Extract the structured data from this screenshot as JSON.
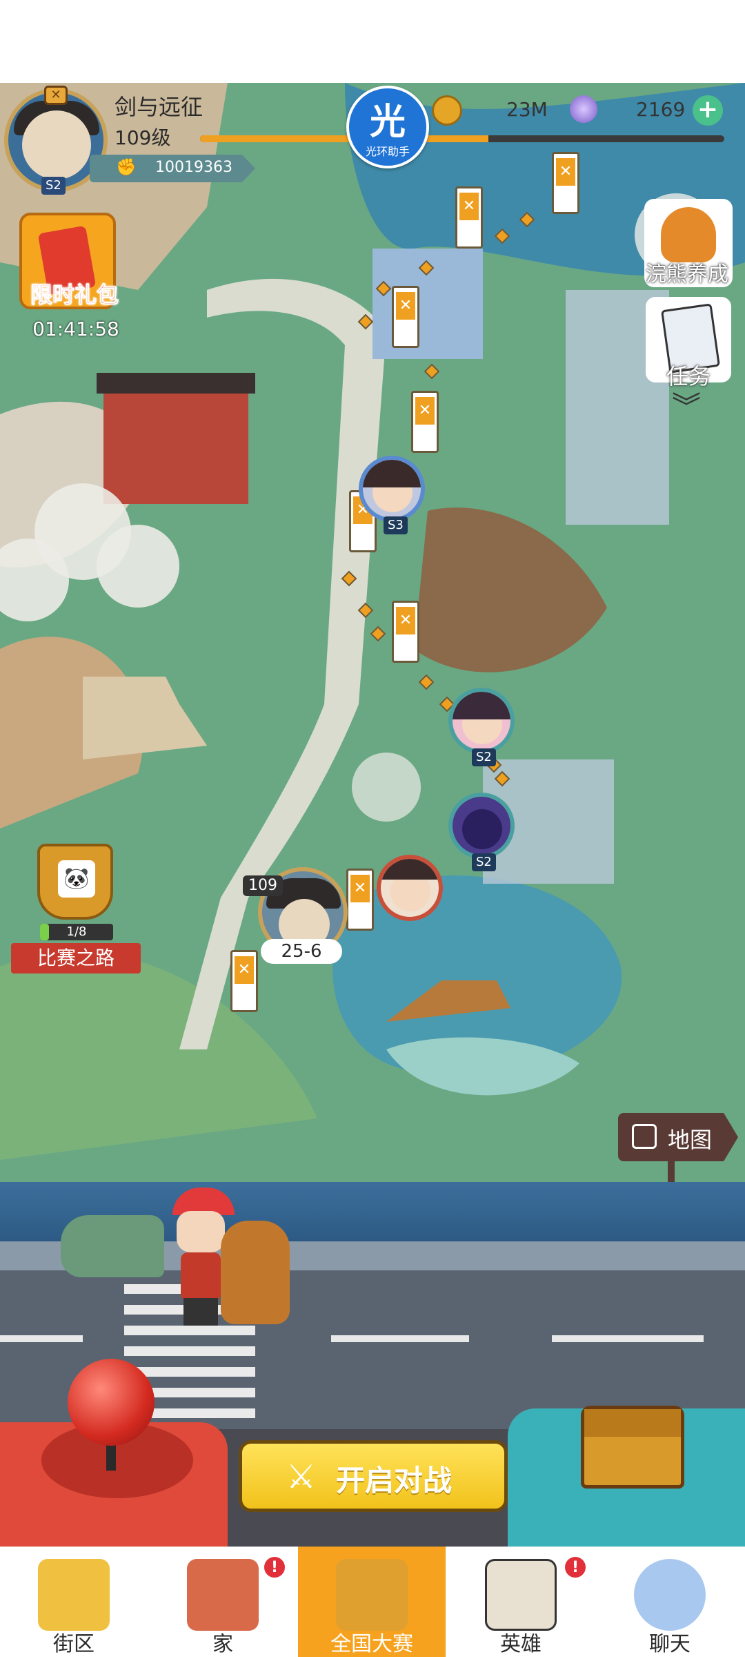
{
  "player": {
    "name": "剑与远征",
    "level": "109级",
    "avatar_badge": "S2",
    "power": "10019363",
    "xp_fraction": 0.55
  },
  "helper": {
    "glyph": "光",
    "label": "光环助手"
  },
  "currency": {
    "coins": "23M",
    "gems": "2169",
    "coin_icon": "gold-coin-icon",
    "gem_icon": "crystal-icon",
    "add_icon": "plus-icon"
  },
  "left_panel": {
    "gift_label": "限时礼包",
    "gift_timer": "01:41:58",
    "race_progress": "1/8",
    "race_progress_fraction": 0.125,
    "race_label": "比赛之路"
  },
  "right_panel": {
    "raccoon_label": "浣熊养成",
    "tasks_label": "任务",
    "map_label": "地图"
  },
  "map": {
    "opponents": [
      {
        "badge": "S3"
      },
      {
        "badge": "S2"
      },
      {
        "badge": "S2"
      }
    ],
    "player_marker": {
      "level": "109",
      "stage": "25-6"
    }
  },
  "start_battle": {
    "label": "开启对战"
  },
  "bottom_nav": {
    "items": [
      {
        "label": "街区",
        "icon": "signpost-icon"
      },
      {
        "label": "家",
        "icon": "house-icon",
        "badge": "!"
      },
      {
        "label": "全国大赛",
        "icon": "trophy-icon"
      },
      {
        "label": "英雄",
        "icon": "hero-cards-icon",
        "badge": "!"
      },
      {
        "label": "聊天",
        "icon": "chat-bubble-icon"
      }
    ],
    "active_index": 2
  },
  "colors": {
    "accent": "#f6a21e",
    "xp_bar": "#f0a020",
    "helper_blue": "#1f74d6",
    "button_yellow": "#f2c21a"
  }
}
